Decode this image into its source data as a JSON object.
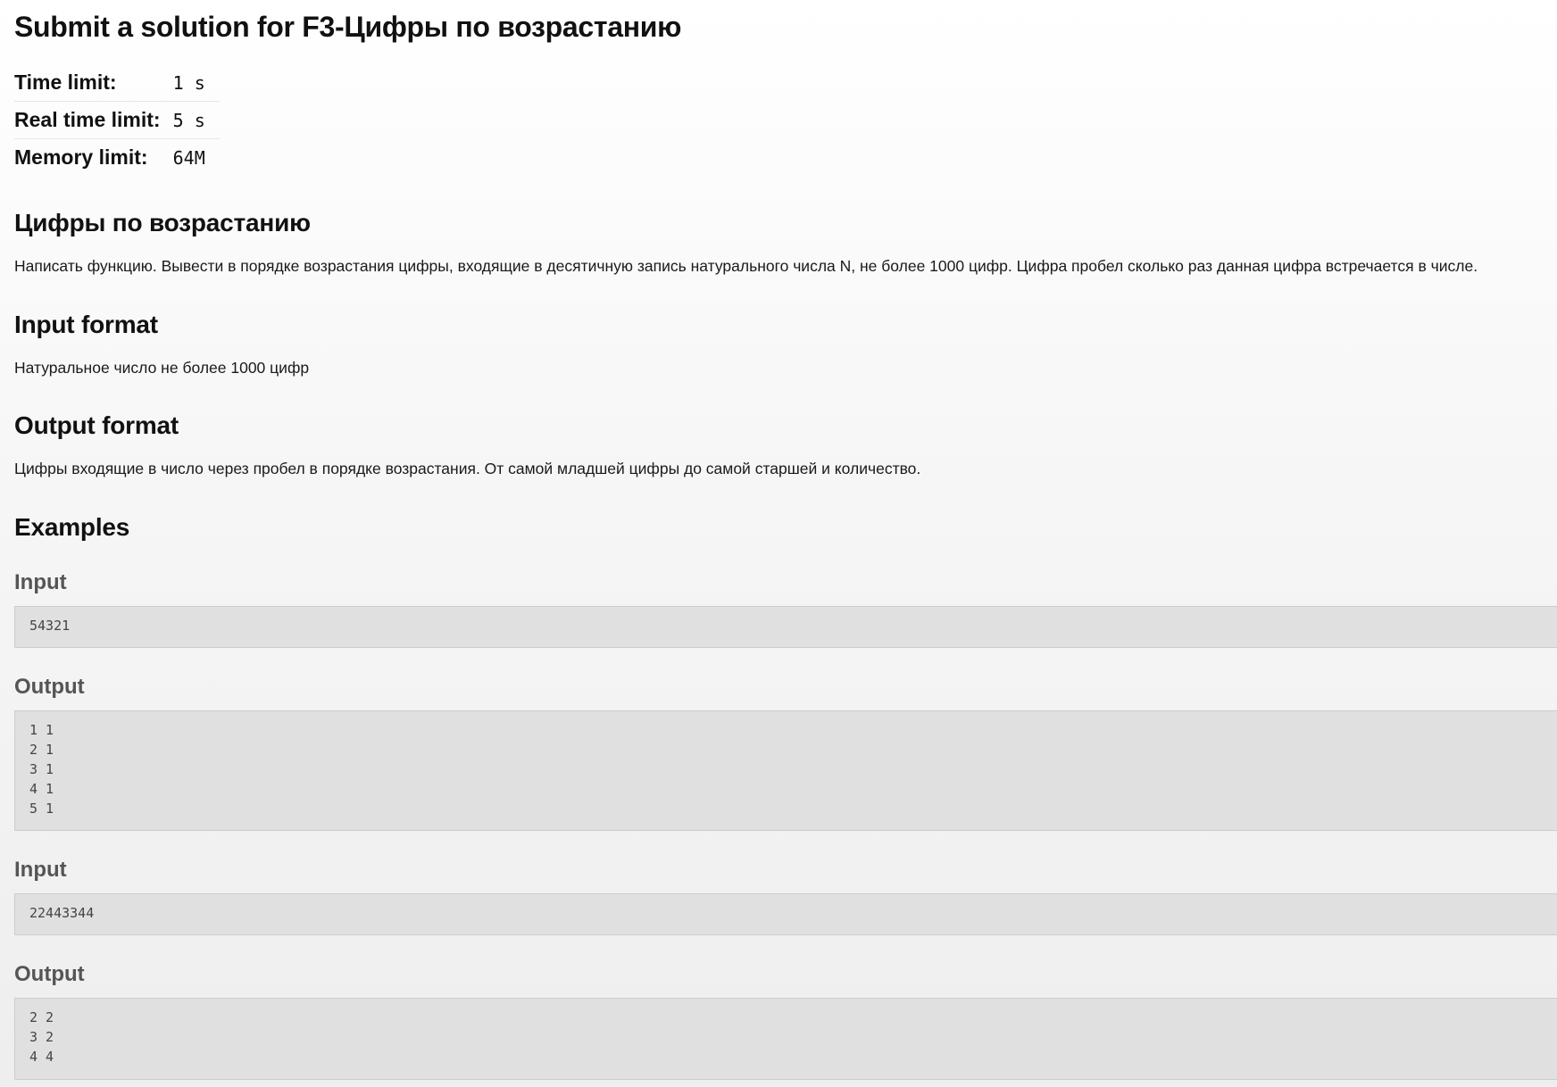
{
  "page": {
    "title": "Submit a solution for F3-Цифры по возрастанию"
  },
  "limits": [
    {
      "label": "Time limit:",
      "value": "1 s"
    },
    {
      "label": "Real time limit:",
      "value": "5 s"
    },
    {
      "label": "Memory limit:",
      "value": "64M"
    }
  ],
  "problem": {
    "title": "Цифры по возрастанию",
    "statement": "Написать функцию. Вывести в порядке возрастания цифры, входящие в десятичную запись натурального числа N, не более 1000 цифр. Цифра пробел сколько раз данная цифра встречается в числе."
  },
  "input_format": {
    "title": "Input format",
    "text": "Натуральное число не более 1000 цифр"
  },
  "output_format": {
    "title": "Output format",
    "text": "Цифры входящие в число через пробел в порядке возрастания. От самой младшей цифры до самой старшей и количество."
  },
  "examples": {
    "title": "Examples",
    "items": [
      {
        "input_label": "Input",
        "input": "54321",
        "output_label": "Output",
        "output": "1 1\n2 1\n3 1\n4 1\n5 1"
      },
      {
        "input_label": "Input",
        "input": "22443344",
        "output_label": "Output",
        "output": "2 2\n3 2\n4 4"
      }
    ]
  }
}
